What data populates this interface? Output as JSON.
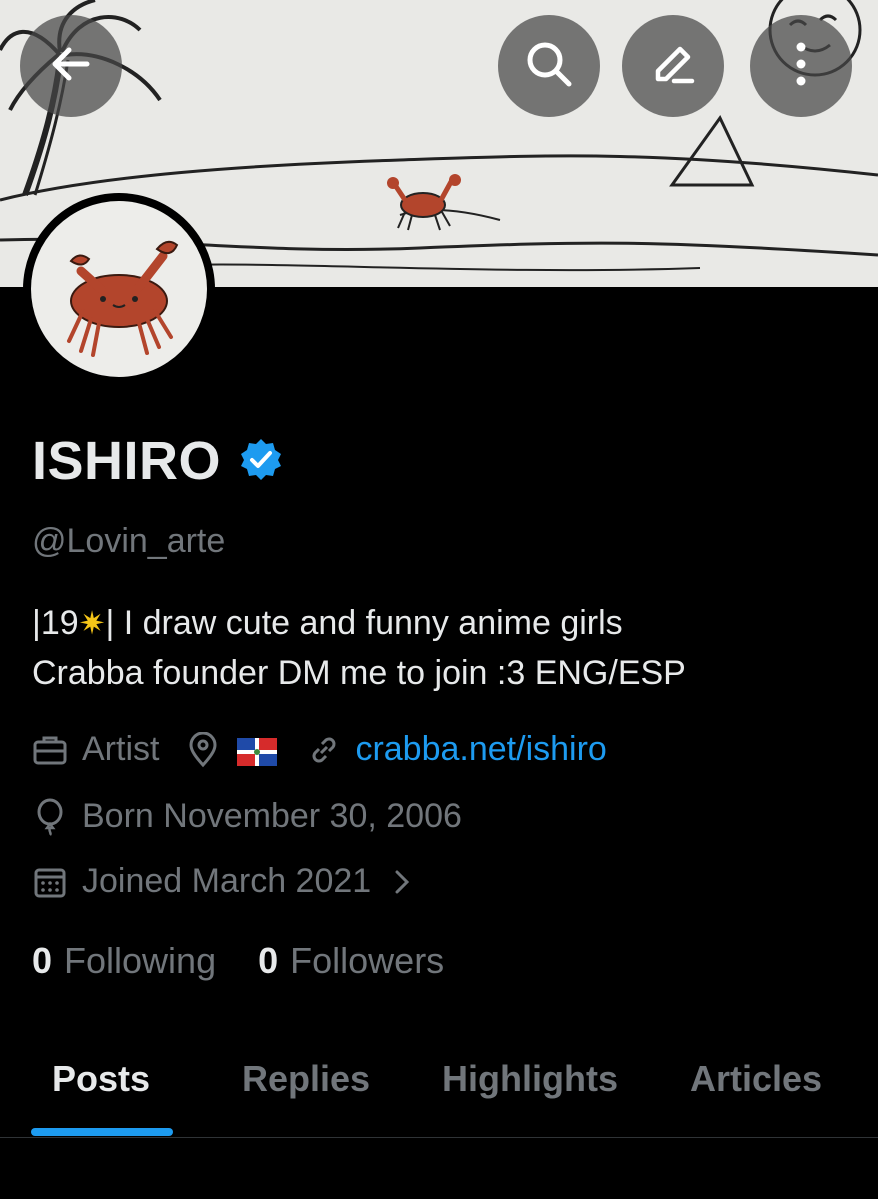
{
  "profile": {
    "name": "ISHIRO",
    "handle": "@Lovin_arte",
    "bio_prefix": "|19",
    "bio_suffix": "| I draw cute and funny anime girls",
    "bio_line2": "Crabba founder DM me to join :3 ENG/ESP",
    "profession": "Artist",
    "website": "crabba.net/ishiro",
    "born": "Born November 30, 2006",
    "joined": "Joined March 2021",
    "following_count": "0",
    "following_label": "Following",
    "followers_count": "0",
    "followers_label": "Followers"
  },
  "tabs": [
    {
      "label": "Posts",
      "active": true
    },
    {
      "label": "Replies",
      "active": false
    },
    {
      "label": "Highlights",
      "active": false
    },
    {
      "label": "Articles",
      "active": false
    }
  ],
  "icons": {
    "back": "back-arrow-icon",
    "search": "search-icon",
    "compose": "edit-icon",
    "more": "more-vertical-icon",
    "verified": "verified-badge-icon",
    "profession": "briefcase-icon",
    "location": "location-pin-icon",
    "website": "link-icon",
    "birthday": "balloon-icon",
    "joined": "calendar-icon",
    "chevron": "chevron-right-icon"
  },
  "colors": {
    "accent": "#1d9bf0",
    "background": "#000000",
    "text_primary": "#e7e9ea",
    "text_secondary": "#71767b"
  }
}
